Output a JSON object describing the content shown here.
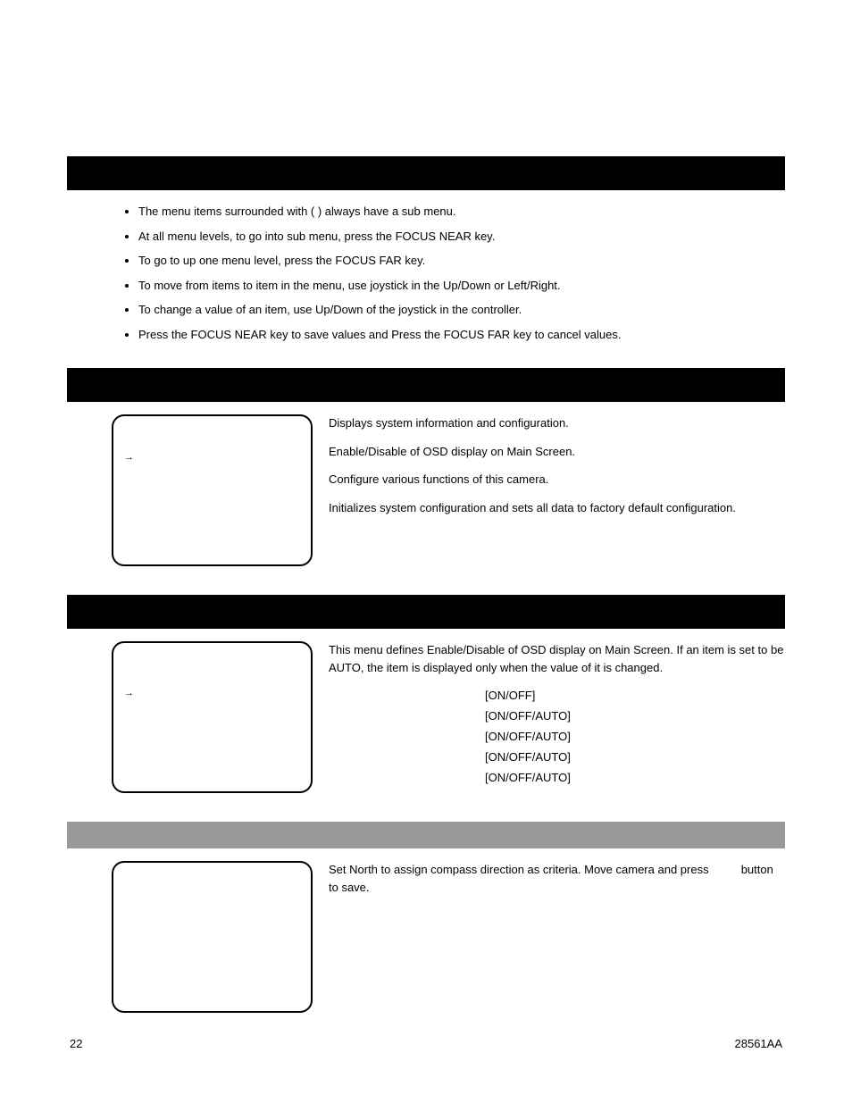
{
  "sections": {
    "general_rules": {
      "title": "",
      "bullets": [
        "The menu items surrounded with (  ) always have a sub menu.",
        "At all menu levels, to go into sub menu, press the FOCUS NEAR key.",
        "To go to up one menu level, press the FOCUS FAR key.",
        "To move from items to item in the menu, use joystick in the Up/Down or Left/Right.",
        "To change a value of an item, use Up/Down of the joystick in the controller.",
        "Press the FOCUS NEAR key to save values and Press the FOCUS FAR key to cancel values."
      ]
    },
    "main_menu": {
      "title": "",
      "descriptions": [
        "Displays system information and configuration.",
        "Enable/Disable of OSD display on Main Screen.",
        "Configure various functions of this camera.",
        "Initializes system configuration and sets all data to factory default configuration."
      ]
    },
    "display_setup": {
      "title": "",
      "intro": "This menu defines Enable/Disable of OSD display on Main Screen. If an item is set to be AUTO, the item is displayed only when the value of it is changed.",
      "rows": [
        {
          "label": "",
          "opts": "[ON/OFF]"
        },
        {
          "label": "",
          "opts": "[ON/OFF/AUTO]"
        },
        {
          "label": "",
          "opts": "[ON/OFF/AUTO]"
        },
        {
          "label": "",
          "opts": "[ON/OFF/AUTO]"
        },
        {
          "label": "",
          "opts": "[ON/OFF/AUTO]"
        }
      ]
    },
    "compass": {
      "title": "",
      "text_a": "Set North to assign compass direction as criteria. Move camera and press ",
      "text_b": " button to save."
    }
  },
  "footer": {
    "page": "22",
    "doc": "28561AA"
  }
}
